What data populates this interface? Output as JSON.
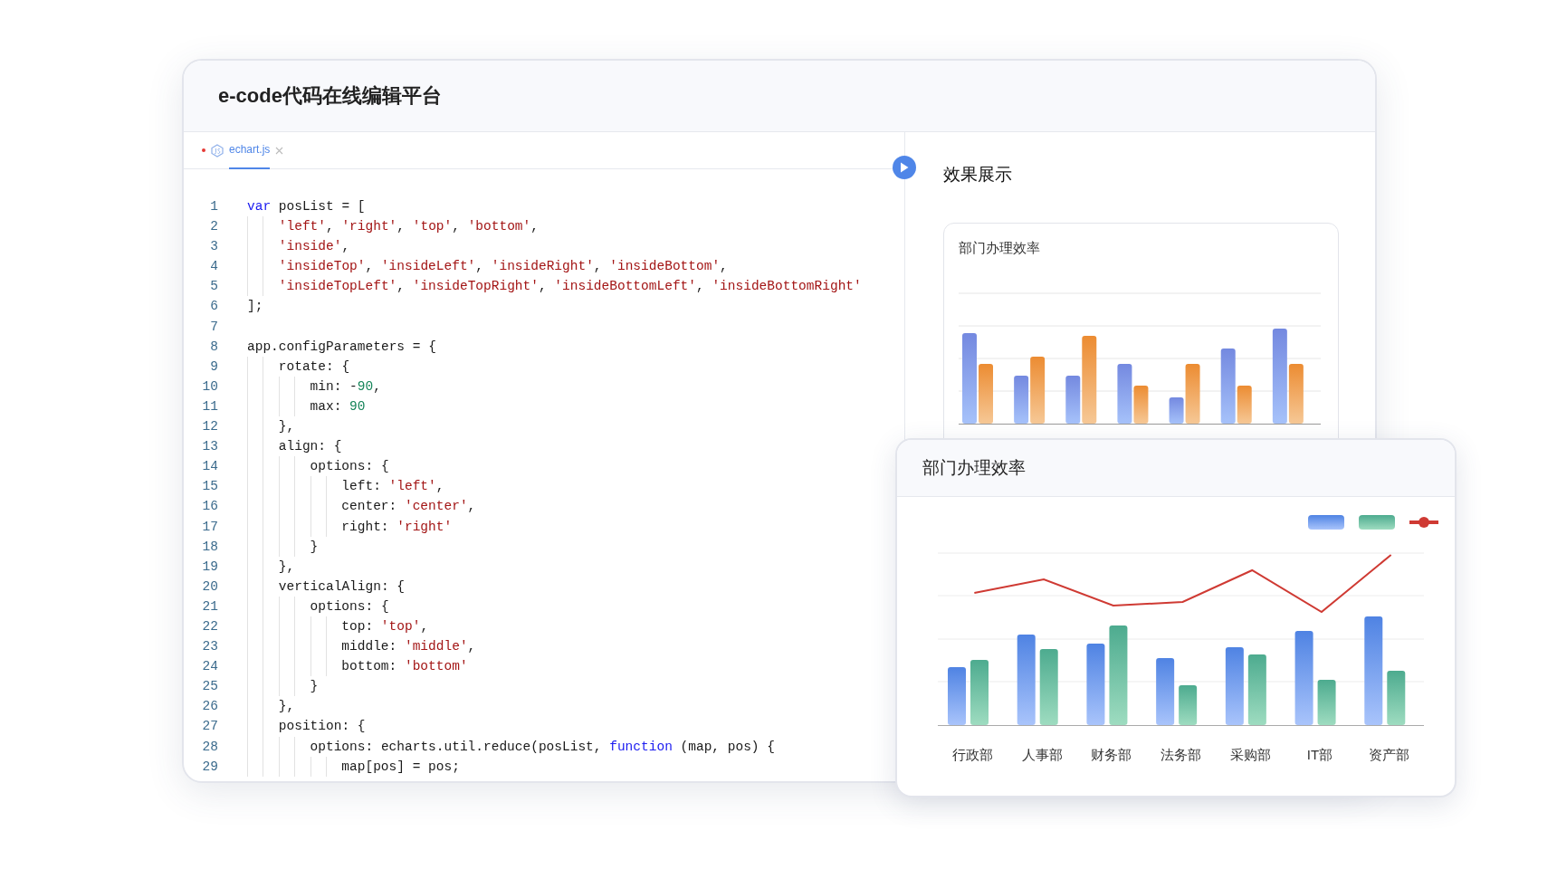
{
  "window": {
    "title": "e-code代码在线编辑平台"
  },
  "editor": {
    "tabs": [
      {
        "label": "echart.js",
        "selected": true,
        "modified": true
      }
    ],
    "lines": [
      {
        "number": "1",
        "tokens": [
          {
            "kind": "keyword",
            "text": "var"
          },
          {
            "kind": "plain",
            "text": " posList = ["
          }
        ]
      },
      {
        "number": "2",
        "tokens": [
          {
            "kind": "string",
            "text": "    'left'"
          },
          {
            "kind": "plain",
            "text": ", "
          },
          {
            "kind": "string",
            "text": "'right'"
          },
          {
            "kind": "plain",
            "text": ", "
          },
          {
            "kind": "string",
            "text": "'top'"
          },
          {
            "kind": "plain",
            "text": ", "
          },
          {
            "kind": "string",
            "text": "'bottom'"
          },
          {
            "kind": "plain",
            "text": ","
          }
        ]
      },
      {
        "number": "3",
        "tokens": [
          {
            "kind": "string",
            "text": "    'inside'"
          },
          {
            "kind": "plain",
            "text": ","
          }
        ]
      },
      {
        "number": "4",
        "tokens": [
          {
            "kind": "string",
            "text": "    'insideTop'"
          },
          {
            "kind": "plain",
            "text": ", "
          },
          {
            "kind": "string",
            "text": "'insideLeft'"
          },
          {
            "kind": "plain",
            "text": ", "
          },
          {
            "kind": "string",
            "text": "'insideRight'"
          },
          {
            "kind": "plain",
            "text": ", "
          },
          {
            "kind": "string",
            "text": "'insideBottom'"
          },
          {
            "kind": "plain",
            "text": ","
          }
        ]
      },
      {
        "number": "5",
        "tokens": [
          {
            "kind": "string",
            "text": "    'insideTopLeft'"
          },
          {
            "kind": "plain",
            "text": ", "
          },
          {
            "kind": "string",
            "text": "'insideTopRight'"
          },
          {
            "kind": "plain",
            "text": ", "
          },
          {
            "kind": "string",
            "text": "'insideBottomLeft'"
          },
          {
            "kind": "plain",
            "text": ", "
          },
          {
            "kind": "string",
            "text": "'insideBottomRight'"
          }
        ]
      },
      {
        "number": "6",
        "tokens": [
          {
            "kind": "plain",
            "text": "];"
          }
        ]
      },
      {
        "number": "7"
      },
      {
        "number": "8",
        "tokens": [
          {
            "kind": "plain",
            "text": "app.configParameters = {"
          }
        ]
      },
      {
        "number": "9",
        "tokens": [
          {
            "kind": "plain",
            "text": "    rotate: {"
          }
        ]
      },
      {
        "number": "10",
        "tokens": [
          {
            "kind": "plain",
            "text": "        min: -"
          },
          {
            "kind": "number",
            "text": "90"
          },
          {
            "kind": "plain",
            "text": ","
          }
        ]
      },
      {
        "number": "11",
        "tokens": [
          {
            "kind": "plain",
            "text": "        max: "
          },
          {
            "kind": "number",
            "text": "90"
          }
        ]
      },
      {
        "number": "12",
        "tokens": [
          {
            "kind": "plain",
            "text": "    },"
          }
        ]
      },
      {
        "number": "13",
        "tokens": [
          {
            "kind": "plain",
            "text": "    align: {"
          }
        ]
      },
      {
        "number": "14",
        "tokens": [
          {
            "kind": "plain",
            "text": "        options: {"
          }
        ]
      },
      {
        "number": "15",
        "tokens": [
          {
            "kind": "plain",
            "text": "            left: "
          },
          {
            "kind": "string",
            "text": "'left'"
          },
          {
            "kind": "plain",
            "text": ","
          }
        ]
      },
      {
        "number": "16",
        "tokens": [
          {
            "kind": "plain",
            "text": "            center: "
          },
          {
            "kind": "string",
            "text": "'center'"
          },
          {
            "kind": "plain",
            "text": ","
          }
        ]
      },
      {
        "number": "17",
        "tokens": [
          {
            "kind": "plain",
            "text": "            right: "
          },
          {
            "kind": "string",
            "text": "'right'"
          }
        ]
      },
      {
        "number": "18",
        "tokens": [
          {
            "kind": "plain",
            "text": "        }"
          }
        ]
      },
      {
        "number": "19",
        "tokens": [
          {
            "kind": "plain",
            "text": "    },"
          }
        ]
      },
      {
        "number": "20",
        "tokens": [
          {
            "kind": "plain",
            "text": "    verticalAlign: {"
          }
        ]
      },
      {
        "number": "21",
        "tokens": [
          {
            "kind": "plain",
            "text": "        options: {"
          }
        ]
      },
      {
        "number": "22",
        "tokens": [
          {
            "kind": "plain",
            "text": "            top: "
          },
          {
            "kind": "string",
            "text": "'top'"
          },
          {
            "kind": "plain",
            "text": ","
          }
        ]
      },
      {
        "number": "23",
        "tokens": [
          {
            "kind": "plain",
            "text": "            middle: "
          },
          {
            "kind": "string",
            "text": "'middle'"
          },
          {
            "kind": "plain",
            "text": ","
          }
        ]
      },
      {
        "number": "24",
        "tokens": [
          {
            "kind": "plain",
            "text": "            bottom: "
          },
          {
            "kind": "string",
            "text": "'bottom'"
          }
        ]
      },
      {
        "number": "25",
        "tokens": [
          {
            "kind": "plain",
            "text": "        }"
          }
        ]
      },
      {
        "number": "26",
        "tokens": [
          {
            "kind": "plain",
            "text": "    },"
          }
        ]
      },
      {
        "number": "27",
        "tokens": [
          {
            "kind": "plain",
            "text": "    position: {"
          }
        ]
      },
      {
        "number": "28",
        "tokens": [
          {
            "kind": "plain",
            "text": "        options: echarts.util.reduce(posList, "
          },
          {
            "kind": "keyword",
            "text": "function"
          },
          {
            "kind": "plain",
            "text": " (map, pos) {"
          }
        ]
      },
      {
        "number": "29",
        "tokens": [
          {
            "kind": "plain",
            "text": "            map[pos] = pos;"
          }
        ]
      }
    ]
  },
  "preview": {
    "title": "效果展示",
    "chart_card": {
      "title": "部门办理效率"
    }
  },
  "popup_chart": {
    "title": "部门办理效率",
    "x_labels": [
      "行政部",
      "人事部",
      "财务部",
      "法务部",
      "采购部",
      "IT部",
      "资产部"
    ]
  }
}
